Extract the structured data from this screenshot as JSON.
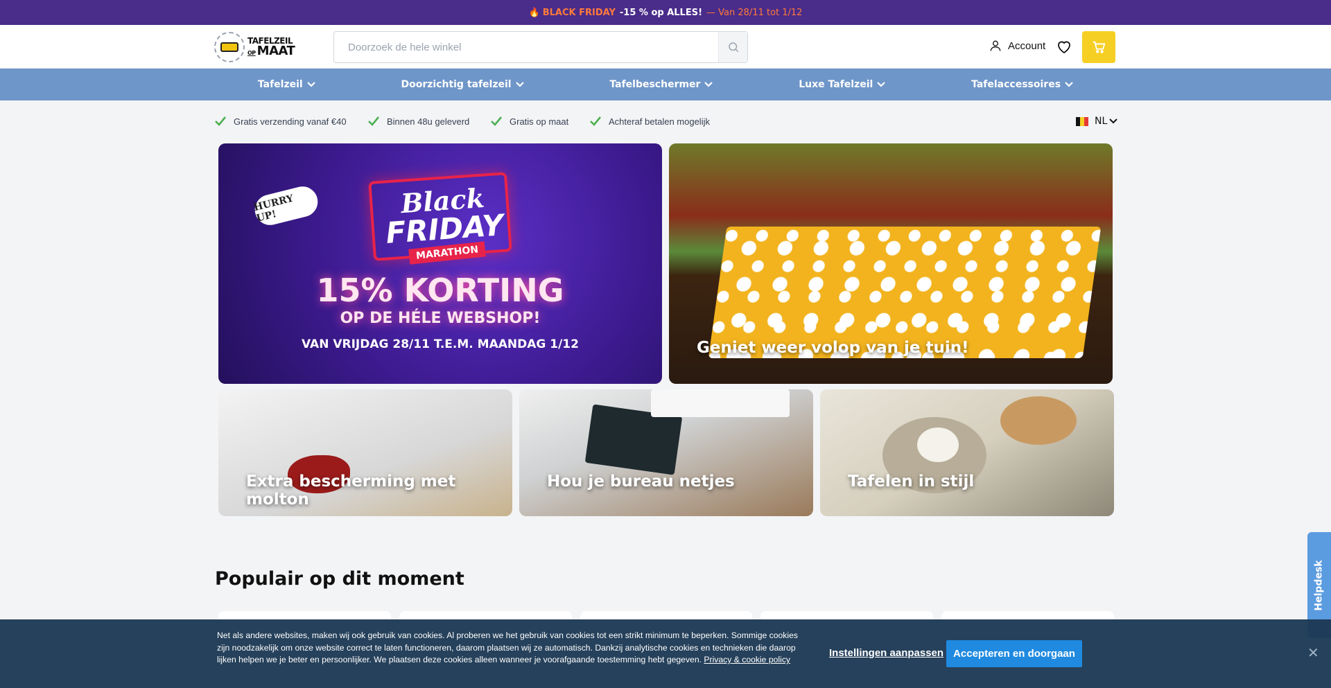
{
  "promo": {
    "flame": "🔥",
    "label": "BLACK FRIDAY",
    "offer": "-15 % op ALLES!",
    "dates": "— Van 28/11 tot 1/12"
  },
  "header": {
    "logo_line1": "TAFELZEIL",
    "logo_op": "OP",
    "logo_line2": "MAAT",
    "search_placeholder": "Doorzoek de hele winkel",
    "account_label": "Account",
    "icons": {
      "search": "search-icon",
      "account": "user-icon",
      "wishlist": "heart-icon",
      "cart": "cart-icon"
    },
    "cart_color": "#f6cf24"
  },
  "nav": {
    "items": [
      {
        "label": "Tafelzeil"
      },
      {
        "label": "Doorzichtig tafelzeil"
      },
      {
        "label": "Tafelbeschermer"
      },
      {
        "label": "Luxe Tafelzeil"
      },
      {
        "label": "Tafelaccessoires"
      }
    ],
    "color": "#6f96c9"
  },
  "usps": {
    "items": [
      {
        "label": "Gratis verzending vanaf €40"
      },
      {
        "label": "Binnen 48u geleverd"
      },
      {
        "label": "Gratis op maat"
      },
      {
        "label": "Achteraf betalen mogelijk"
      }
    ],
    "check_color": "#4caf50",
    "language": "NL"
  },
  "banners": {
    "main": {
      "hurry": "HURRY UP!",
      "title_line1": "Black",
      "title_line2": "FRIDAY",
      "tag": "MARATHON",
      "discount": "15% KORTING",
      "subtitle": "OP DE HÉLE WEBSHOP!",
      "dates": "VAN VRIJDAG 28/11 T.E.M. MAANDAG 1/12"
    },
    "garden": {
      "caption": "Geniet weer volop van je tuin!"
    },
    "molton": {
      "caption": "Extra bescherming met molton"
    },
    "desk": {
      "caption": "Hou je bureau netjes"
    },
    "style": {
      "caption": "Tafelen in stijl"
    }
  },
  "popular": {
    "title": "Populair op dit moment"
  },
  "helpdesk": {
    "label": "Helpdesk"
  },
  "cookie": {
    "text": "Net als andere websites, maken wij ook gebruik van cookies. Al proberen we het gebruik van cookies tot een strikt minimum te beperken. Sommige cookies zijn noodzakelijk om onze website correct te laten functioneren, daarom plaatsen wij ze automatisch. Dankzij analytische cookies en technieken die daarop lijken helpen we je beter en persoonlijker. We plaatsen deze cookies alleen wanneer je voorafgaande toestemming hebt gegeven.",
    "link": "Privacy & cookie policy",
    "settings": "Instellingen aanpassen",
    "accept": "Accepteren en doorgaan",
    "close": "✕"
  }
}
